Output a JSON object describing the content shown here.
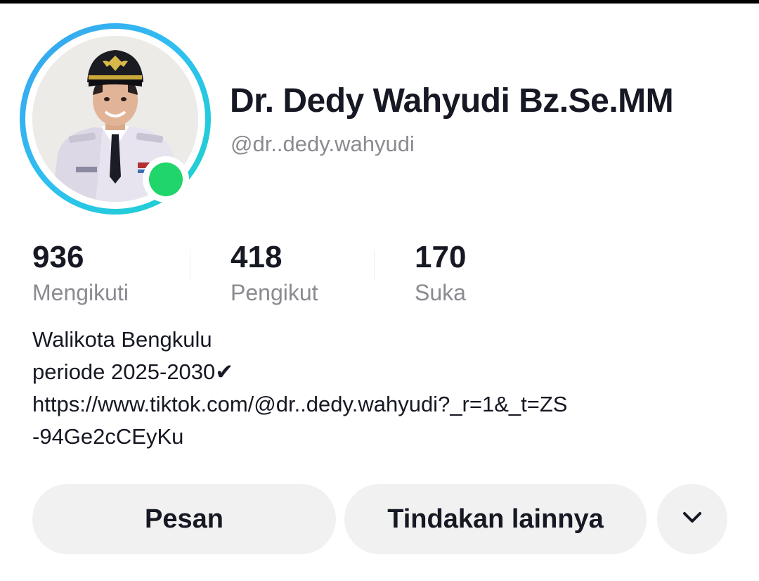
{
  "profile": {
    "display_name": "Dr. Dedy Wahyudi Bz.Se.MM",
    "username": "@dr..dedy.wahyudi",
    "online": true
  },
  "stats": [
    {
      "value": "936",
      "label": "Mengikuti"
    },
    {
      "value": "418",
      "label": "Pengikut"
    },
    {
      "value": "170",
      "label": "Suka"
    }
  ],
  "bio": {
    "line1": "Walikota Bengkulu",
    "line2": "periode 2025-2030✔",
    "line3": "https://www.tiktok.com/@dr..dedy.wahyudi?_r=1&_t=ZS",
    "line4": "-94Ge2cCEyKu"
  },
  "actions": {
    "message_label": "Pesan",
    "more_actions_label": "Tindakan lainnya",
    "dropdown_icon": "chevron-down-icon"
  },
  "colors": {
    "ring_gradient_start": "#3aa3f0",
    "ring_gradient_end": "#1ad5c8",
    "online": "#20d56a",
    "secondary_text": "#8a8b91",
    "button_bg": "#f1f1f2"
  }
}
